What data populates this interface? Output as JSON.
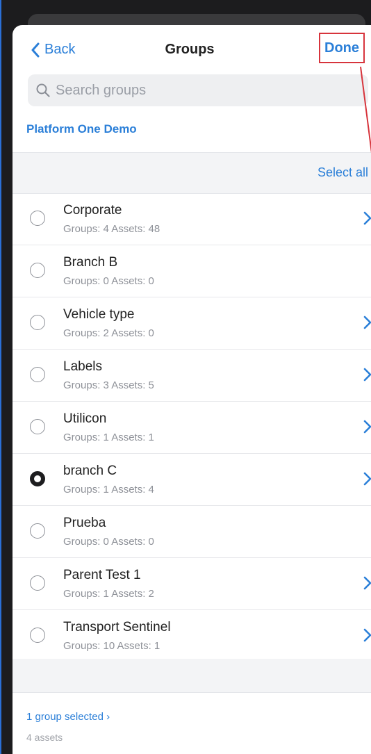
{
  "navbar": {
    "back_label": "Back",
    "title": "Groups",
    "done_label": "Done"
  },
  "search": {
    "placeholder": "Search groups",
    "value": ""
  },
  "organization": "Platform One Demo",
  "select_all_label": "Select all",
  "groups": [
    {
      "name": "Corporate",
      "meta": "Groups: 4 Assets: 48",
      "selected": false,
      "has_children": true
    },
    {
      "name": "Branch B",
      "meta": "Groups: 0 Assets: 0",
      "selected": false,
      "has_children": false
    },
    {
      "name": "Vehicle type",
      "meta": "Groups: 2 Assets: 0",
      "selected": false,
      "has_children": true
    },
    {
      "name": "Labels",
      "meta": "Groups: 3 Assets: 5",
      "selected": false,
      "has_children": true
    },
    {
      "name": "Utilicon",
      "meta": "Groups: 1 Assets: 1",
      "selected": false,
      "has_children": true
    },
    {
      "name": "branch C",
      "meta": "Groups: 1 Assets: 4",
      "selected": true,
      "has_children": true
    },
    {
      "name": "Prueba",
      "meta": "Groups: 0 Assets: 0",
      "selected": false,
      "has_children": false
    },
    {
      "name": "Parent Test 1",
      "meta": "Groups: 1 Assets: 2",
      "selected": false,
      "has_children": true
    },
    {
      "name": "Transport Sentinel",
      "meta": "Groups: 10 Assets: 1",
      "selected": false,
      "has_children": true
    }
  ],
  "footer": {
    "selected_label": "1 group selected ›",
    "assets_label": "4 assets"
  },
  "colors": {
    "accent": "#2b7fd8",
    "highlight": "#d7343c"
  }
}
